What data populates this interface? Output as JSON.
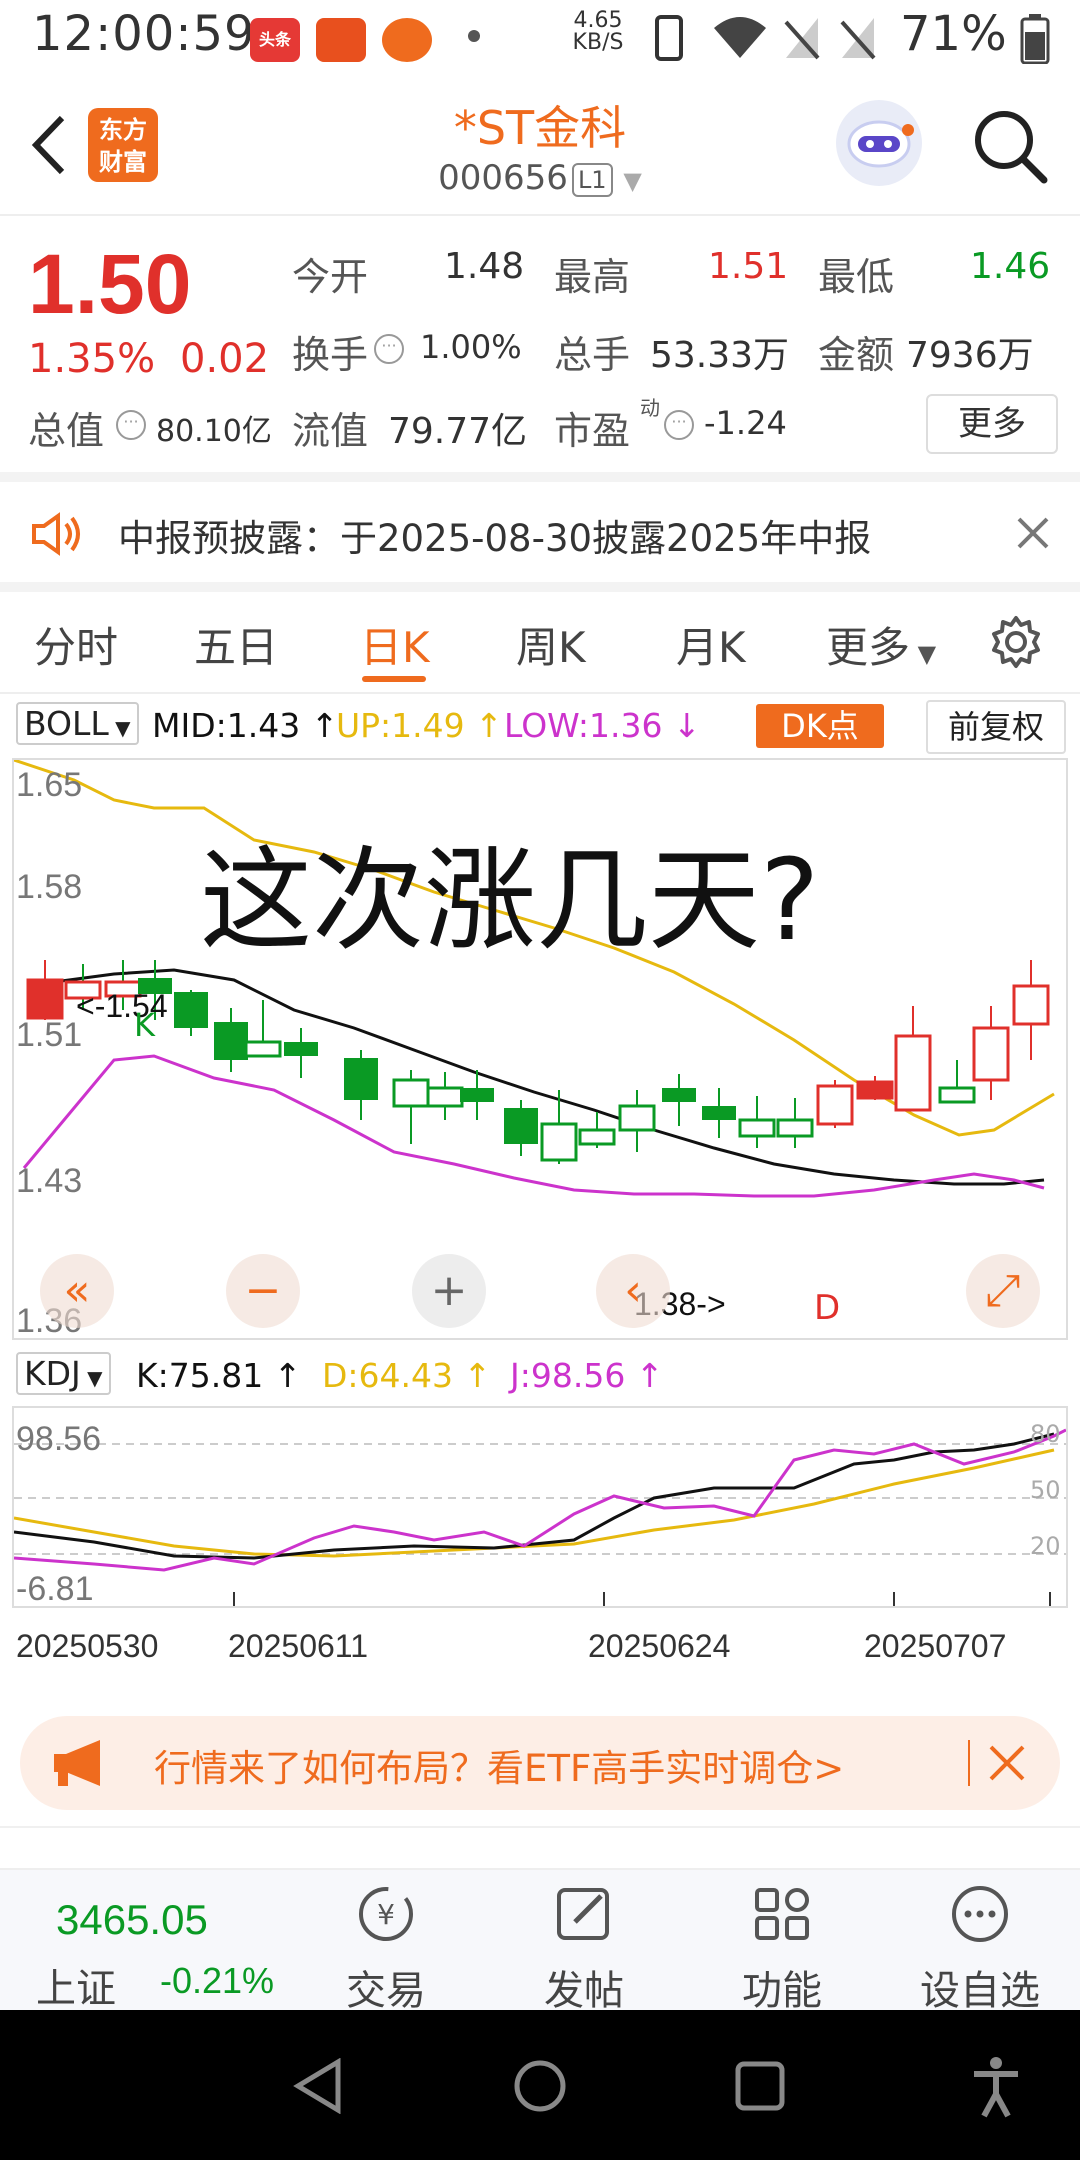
{
  "status_bar": {
    "time": "12:00:59",
    "app1": "头条",
    "net_speed_value": "4.65",
    "net_speed_unit": "KB/S",
    "battery": "71%"
  },
  "header": {
    "logo_line1": "东方",
    "logo_line2": "财富",
    "stock_name": "*ST金科",
    "stock_code": "000656",
    "level": "L1"
  },
  "quote": {
    "price": "1.50",
    "change_pct": "1.35%",
    "change": "0.02",
    "open_label": "今开",
    "open": "1.48",
    "high_label": "最高",
    "high": "1.51",
    "low_label": "最低",
    "low": "1.46",
    "turnover_label": "换手",
    "turnover": "1.00%",
    "volume_label": "总手",
    "volume": "53.33万",
    "amount_label": "金额",
    "amount": "7936万",
    "mktcap_label": "总值",
    "mktcap": "80.10亿",
    "float_label": "流值",
    "float_cap": "79.77亿",
    "pe_label": "市盈",
    "pe_sup": "动",
    "pe": "-1.24",
    "more": "更多"
  },
  "notice": {
    "text": "中报预披露：于2025-08-30披露2025年中报"
  },
  "tabs": [
    "分时",
    "五日",
    "日K",
    "周K",
    "月K",
    "更多"
  ],
  "active_tab": 2,
  "boll": {
    "selector": "BOLL",
    "mid": "MID:1.43",
    "up": "UP:1.49",
    "low": "LOW:1.36",
    "dk": "DK点",
    "adjust": "前复权"
  },
  "kchart": {
    "y_labels": [
      "1.65",
      "1.58",
      "1.51",
      "1.43",
      "1.36"
    ],
    "high_marker": "<-1.54",
    "low_marker": "1.38->",
    "k_letter": "K",
    "d_letter": "D",
    "overlay": "这次涨几天?"
  },
  "kdj": {
    "selector": "KDJ",
    "k": "K:75.81",
    "d": "D:64.43",
    "j": "J:98.56",
    "y_top": "98.56",
    "y_bottom": "-6.81",
    "right_labels": [
      "80",
      "50",
      "20"
    ]
  },
  "dates": [
    "20250530",
    "20250611",
    "20250624",
    "20250707"
  ],
  "ad": {
    "text": "行情来了如何布局？看ETF高手实时调仓>"
  },
  "bottom_nav": {
    "index_value": "3465.05",
    "index_name": "上证",
    "index_change": "-0.21%",
    "items": [
      "交易",
      "发帖",
      "功能",
      "设自选"
    ]
  },
  "colors": {
    "accent": "#ef6b1e",
    "up": "#e0302b",
    "down": "#0a9a24",
    "boll_up": "#e6b90f",
    "boll_low": "#cc33cc"
  }
}
